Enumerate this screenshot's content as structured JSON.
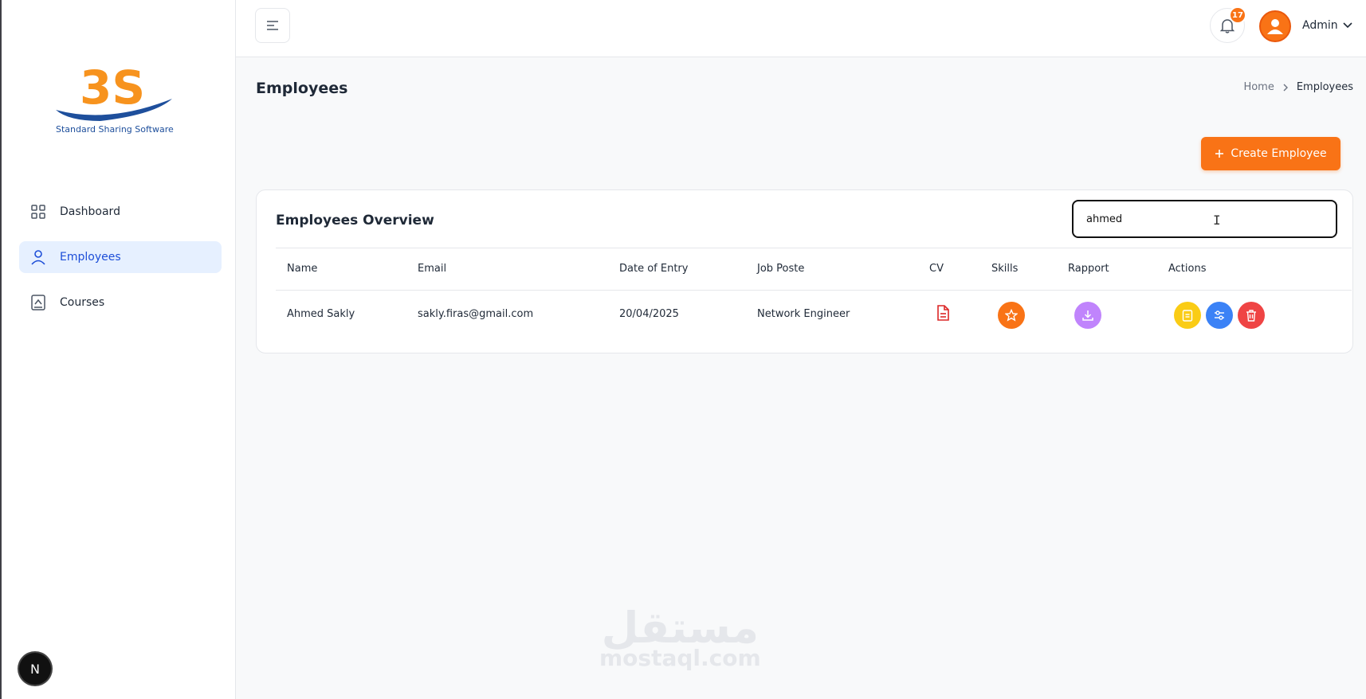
{
  "brand": {
    "logo_text": "3S",
    "tagline": "Standard Sharing Software",
    "primary": "#f97316",
    "blue": "#1e4f9c"
  },
  "sidebar": {
    "items": [
      {
        "label": "Dashboard",
        "icon": "grid-icon",
        "active": false
      },
      {
        "label": "Employees",
        "icon": "user-icon",
        "active": true
      },
      {
        "label": "Courses",
        "icon": "book-icon",
        "active": false
      }
    ],
    "footer_badge": "N"
  },
  "topbar": {
    "notification_count": "17",
    "user_name": "Admin"
  },
  "page": {
    "title": "Employees",
    "breadcrumb": [
      "Home",
      "Employees"
    ]
  },
  "actions": {
    "create_label": "Create Employee"
  },
  "card": {
    "title": "Employees Overview",
    "search_value": "ahmed",
    "columns": [
      "Name",
      "Email",
      "Date of Entry",
      "Job Poste",
      "CV",
      "Skills",
      "Rapport",
      "Actions"
    ],
    "rows": [
      {
        "name": "Ahmed Sakly",
        "email": "sakly.firas@gmail.com",
        "date": "20/04/2025",
        "job": "Network Engineer"
      }
    ]
  },
  "watermark": {
    "arabic": "مستقل",
    "latin": "mostaql.com"
  }
}
